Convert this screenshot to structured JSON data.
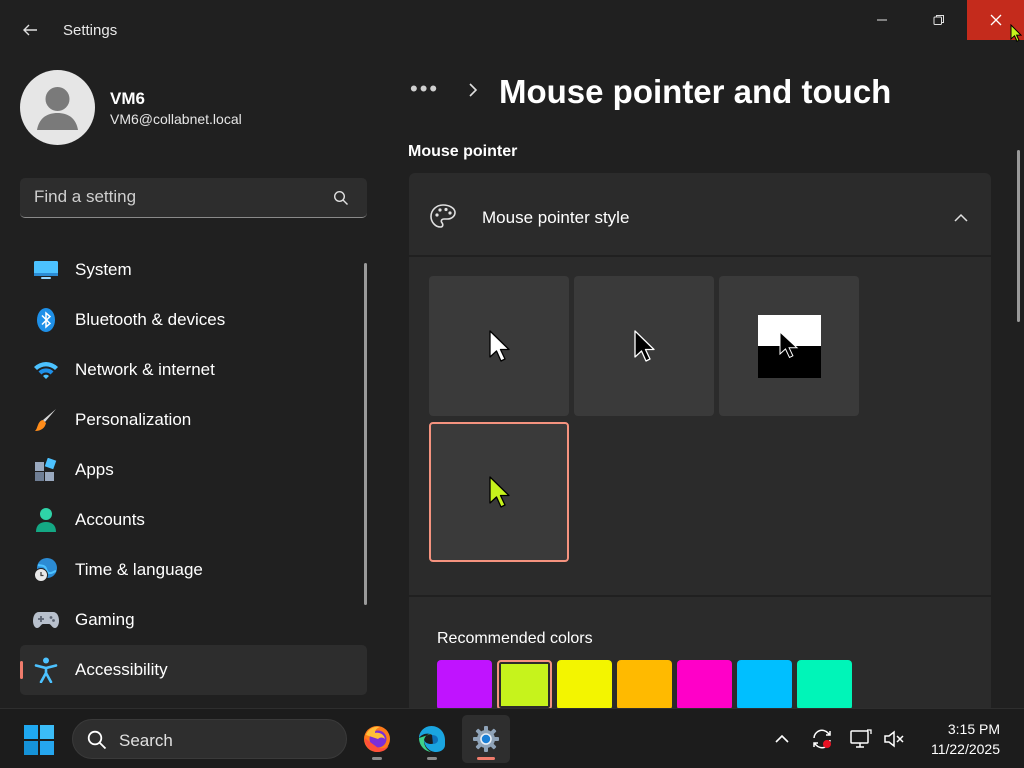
{
  "window": {
    "app_title": "Settings",
    "controls": {
      "minimize_icon": "minimize-icon",
      "maximize_icon": "restore-icon",
      "close_icon": "close-icon"
    }
  },
  "user": {
    "name": "VM6",
    "email": "VM6@collabnet.local"
  },
  "search": {
    "placeholder": "Find a setting"
  },
  "sidebar": {
    "items": [
      {
        "label": "System",
        "icon": "system-icon",
        "active": false
      },
      {
        "label": "Bluetooth & devices",
        "icon": "bluetooth-icon",
        "active": false
      },
      {
        "label": "Network & internet",
        "icon": "wifi-icon",
        "active": false
      },
      {
        "label": "Personalization",
        "icon": "brush-icon",
        "active": false
      },
      {
        "label": "Apps",
        "icon": "apps-icon",
        "active": false
      },
      {
        "label": "Accounts",
        "icon": "accounts-icon",
        "active": false
      },
      {
        "label": "Time & language",
        "icon": "globe-clock-icon",
        "active": false
      },
      {
        "label": "Gaming",
        "icon": "gamepad-icon",
        "active": false
      },
      {
        "label": "Accessibility",
        "icon": "accessibility-icon",
        "active": true
      }
    ]
  },
  "breadcrumb": {
    "overflow": "•••",
    "title": "Mouse pointer and touch"
  },
  "section": {
    "label": "Mouse pointer"
  },
  "pointer_style": {
    "title": "Mouse pointer style",
    "options": [
      {
        "name": "white",
        "selected": false
      },
      {
        "name": "black",
        "selected": false
      },
      {
        "name": "inverted",
        "selected": false
      },
      {
        "name": "custom",
        "selected": true,
        "color": "#c6f31c"
      }
    ]
  },
  "recommended_colors": {
    "label": "Recommended colors",
    "swatches": [
      {
        "color": "#c013ff",
        "selected": false
      },
      {
        "color": "#c6f31c",
        "selected": true
      },
      {
        "color": "#f3f500",
        "selected": false
      },
      {
        "color": "#ffba00",
        "selected": false
      },
      {
        "color": "#ff00c8",
        "selected": false
      },
      {
        "color": "#00bfff",
        "selected": false
      },
      {
        "color": "#00f5b8",
        "selected": false
      }
    ]
  },
  "taskbar": {
    "search_label": "Search",
    "apps": [
      {
        "name": "firefox-icon",
        "active": false
      },
      {
        "name": "edge-icon",
        "active": false
      },
      {
        "name": "settings-icon",
        "active": true
      }
    ],
    "tray": [
      "chevron-up-icon",
      "sync-icon",
      "network-icon",
      "volume-muted-icon"
    ],
    "clock": {
      "time": "3:15 PM",
      "date": "11/22/2025"
    }
  },
  "colors": {
    "accent": "#f07c6c",
    "close_button": "#c42b1c",
    "background": "#202020",
    "card": "#2b2b2b"
  }
}
